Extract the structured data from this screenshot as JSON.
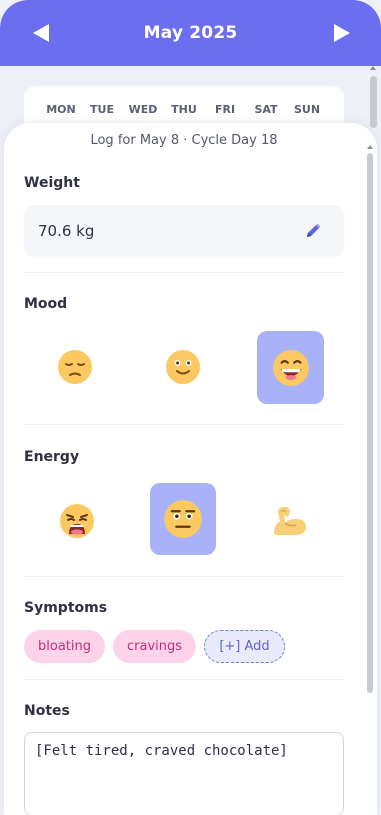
{
  "header": {
    "title": "May 2025",
    "prev_label": "Previous month",
    "next_label": "Next month",
    "accent": "#6c6ef0"
  },
  "calendar": {
    "weekdays": [
      "MON",
      "TUE",
      "WED",
      "THU",
      "FRI",
      "SAT",
      "SUN"
    ]
  },
  "log": {
    "title": "Log for May 8 · Cycle Day 18"
  },
  "weight": {
    "label": "Weight",
    "value": "70.6 kg",
    "edit_icon": "pencil-icon"
  },
  "mood": {
    "label": "Mood",
    "options": [
      {
        "name": "sad",
        "icon": "pensive-face-icon",
        "selected": false
      },
      {
        "name": "neutral",
        "icon": "slightly-smiling-face-icon",
        "selected": false
      },
      {
        "name": "happy",
        "icon": "grinning-face-icon",
        "selected": true
      }
    ]
  },
  "energy": {
    "label": "Energy",
    "options": [
      {
        "name": "low",
        "icon": "weary-face-icon",
        "selected": false
      },
      {
        "name": "medium",
        "icon": "neutral-face-icon",
        "selected": true
      },
      {
        "name": "high",
        "icon": "flexed-biceps-icon",
        "selected": false
      }
    ]
  },
  "symptoms": {
    "label": "Symptoms",
    "chips": [
      "bloating",
      "cravings"
    ],
    "add_label": "[+] Add",
    "chip_color": "#fcd3e8"
  },
  "notes": {
    "label": "Notes",
    "value": "[Felt tired, craved chocolate]"
  }
}
